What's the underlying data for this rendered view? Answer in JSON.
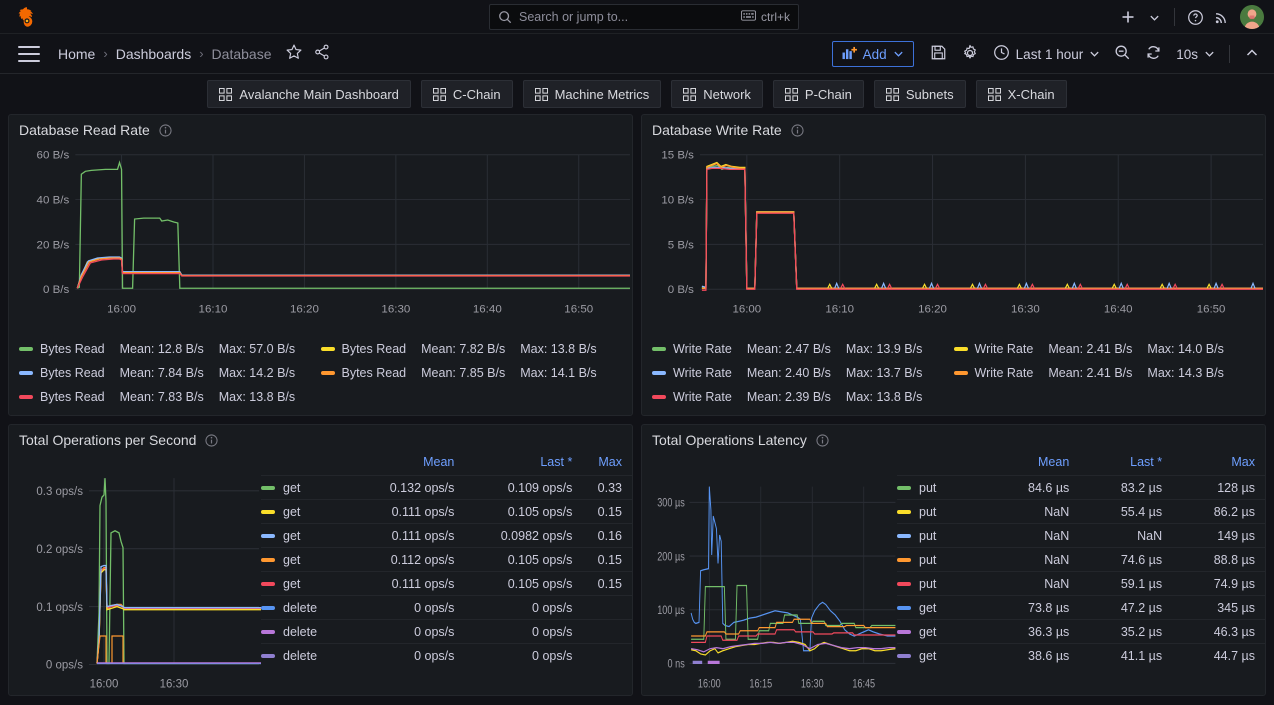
{
  "topnav": {
    "logo_icon": "grafana-logo-icon",
    "search": {
      "placeholder": "Search or jump to...",
      "icon": "search-icon",
      "kbd_icon": "keyboard-icon",
      "kbd_label": "ctrl+k"
    },
    "plus_label": "+",
    "help_icon": "help-circle-icon",
    "news_icon": "rss-news-icon",
    "avatar_icon": "user-avatar"
  },
  "breadcrumb": {
    "menu_icon": "hamburger-menu-icon",
    "items": [
      {
        "label": "Home"
      },
      {
        "label": "Dashboards"
      },
      {
        "label": "Database"
      }
    ],
    "separator": "›",
    "star_icon": "star-outline-icon",
    "share_icon": "share-nodes-icon"
  },
  "toolbar": {
    "add_label": "Add",
    "add_icon": "panel-add-icon",
    "add_chevron": "chevron-down-icon",
    "save_icon": "save-disk-icon",
    "settings_icon": "gear-icon",
    "time_icon": "clock-icon",
    "time_range": "Last 1 hour",
    "time_chevron": "chevron-down-icon",
    "zoom_out_icon": "zoom-out-icon",
    "refresh_icon": "refresh-icon",
    "refresh_interval": "10s",
    "refresh_chevron": "chevron-down-icon",
    "collapse_icon": "chevron-up-icon"
  },
  "dashboard_links": [
    {
      "label": "Avalanche Main Dashboard",
      "icon": "apps-grid-icon"
    },
    {
      "label": "C-Chain",
      "icon": "apps-grid-icon"
    },
    {
      "label": "Machine Metrics",
      "icon": "apps-grid-icon"
    },
    {
      "label": "Network",
      "icon": "apps-grid-icon"
    },
    {
      "label": "P-Chain",
      "icon": "apps-grid-icon"
    },
    {
      "label": "Subnets",
      "icon": "apps-grid-icon"
    },
    {
      "label": "X-Chain",
      "icon": "apps-grid-icon"
    }
  ],
  "colors": {
    "green": "#73BF69",
    "yellow": "#FADE2A",
    "blue": "#8AB8FF",
    "orange": "#FF9830",
    "red": "#F2495C",
    "blue2": "#5794F2",
    "purple": "#B877D9",
    "violet": "#8F7FD0",
    "accent_blue": "#6e9fff",
    "panel_bg": "#181b1f",
    "page_bg": "#111217"
  },
  "panels": [
    {
      "id": "database-read-rate",
      "title": "Database Read Rate",
      "info_icon": "info-circle-icon",
      "legend_layout": "list",
      "chart_data": {
        "type": "line",
        "title": "Database Read Rate",
        "xlabel": "",
        "ylabel": "",
        "ylim": [
          0,
          65
        ],
        "ytick_labels": [
          "0 B/s",
          "20 B/s",
          "40 B/s",
          "60 B/s"
        ],
        "ytick_values": [
          0,
          20,
          40,
          60
        ],
        "xtick_labels": [
          "16:00",
          "16:10",
          "16:20",
          "16:30",
          "16:40",
          "16:50"
        ],
        "grid": true,
        "legend_position": "bottom",
        "series": [
          {
            "name": "Bytes Read",
            "color": "#73BF69",
            "mean": "12.8 B/s",
            "max": "57.0 B/s"
          },
          {
            "name": "Bytes Read",
            "color": "#FADE2A",
            "mean": "7.82 B/s",
            "max": "13.8 B/s"
          },
          {
            "name": "Bytes Read",
            "color": "#8AB8FF",
            "mean": "7.84 B/s",
            "max": "14.2 B/s"
          },
          {
            "name": "Bytes Read",
            "color": "#FF9830",
            "mean": "7.85 B/s",
            "max": "14.1 B/s"
          },
          {
            "name": "Bytes Read",
            "color": "#F2495C",
            "mean": "7.83 B/s",
            "max": "13.8 B/s"
          }
        ]
      },
      "legend": [
        {
          "name": "Bytes Read",
          "color": "#73BF69",
          "stats": [
            "Mean: 12.8 B/s",
            "Max: 57.0 B/s"
          ]
        },
        {
          "name": "Bytes Read",
          "color": "#FADE2A",
          "stats": [
            "Mean: 7.82 B/s",
            "Max: 13.8 B/s"
          ]
        },
        {
          "name": "Bytes Read",
          "color": "#8AB8FF",
          "stats": [
            "Mean: 7.84 B/s",
            "Max: 14.2 B/s"
          ]
        },
        {
          "name": "Bytes Read",
          "color": "#FF9830",
          "stats": [
            "Mean: 7.85 B/s",
            "Max: 14.1 B/s"
          ]
        },
        {
          "name": "Bytes Read",
          "color": "#F2495C",
          "stats": [
            "Mean: 7.83 B/s",
            "Max: 13.8 B/s"
          ]
        }
      ]
    },
    {
      "id": "database-write-rate",
      "title": "Database Write Rate",
      "info_icon": "info-circle-icon",
      "legend_layout": "list",
      "chart_data": {
        "type": "line",
        "title": "Database Write Rate",
        "xlabel": "",
        "ylabel": "",
        "ylim": [
          0,
          16
        ],
        "ytick_labels": [
          "0 B/s",
          "5 B/s",
          "10 B/s",
          "15 B/s"
        ],
        "ytick_values": [
          0,
          5,
          10,
          15
        ],
        "xtick_labels": [
          "16:00",
          "16:10",
          "16:20",
          "16:30",
          "16:40",
          "16:50"
        ],
        "grid": true,
        "legend_position": "bottom",
        "series": [
          {
            "name": "Write Rate",
            "color": "#73BF69",
            "mean": "2.47 B/s",
            "max": "13.9 B/s"
          },
          {
            "name": "Write Rate",
            "color": "#FADE2A",
            "mean": "2.41 B/s",
            "max": "14.0 B/s"
          },
          {
            "name": "Write Rate",
            "color": "#8AB8FF",
            "mean": "2.40 B/s",
            "max": "13.7 B/s"
          },
          {
            "name": "Write Rate",
            "color": "#FF9830",
            "mean": "2.41 B/s",
            "max": "14.3 B/s"
          },
          {
            "name": "Write Rate",
            "color": "#F2495C",
            "mean": "2.39 B/s",
            "max": "13.8 B/s"
          }
        ]
      },
      "legend": [
        {
          "name": "Write Rate",
          "color": "#73BF69",
          "stats": [
            "Mean: 2.47 B/s",
            "Max: 13.9 B/s"
          ]
        },
        {
          "name": "Write Rate",
          "color": "#FADE2A",
          "stats": [
            "Mean: 2.41 B/s",
            "Max: 14.0 B/s"
          ]
        },
        {
          "name": "Write Rate",
          "color": "#8AB8FF",
          "stats": [
            "Mean: 2.40 B/s",
            "Max: 13.7 B/s"
          ]
        },
        {
          "name": "Write Rate",
          "color": "#FF9830",
          "stats": [
            "Mean: 2.41 B/s",
            "Max: 14.3 B/s"
          ]
        },
        {
          "name": "Write Rate",
          "color": "#F2495C",
          "stats": [
            "Mean: 2.39 B/s",
            "Max: 13.8 B/s"
          ]
        }
      ]
    },
    {
      "id": "total-operations-per-second",
      "title": "Total Operations per Second",
      "info_icon": "info-circle-icon",
      "legend_layout": "table",
      "chart_data": {
        "type": "line",
        "title": "Total Operations per Second",
        "xlabel": "",
        "ylabel": "",
        "ylim": [
          0,
          0.35
        ],
        "ytick_labels": [
          "0 ops/s",
          "0.1 ops/s",
          "0.2 ops/s",
          "0.3 ops/s"
        ],
        "ytick_values": [
          0,
          0.1,
          0.2,
          0.3
        ],
        "xtick_labels": [
          "16:00",
          "16:30"
        ],
        "grid": true,
        "legend_position": "right",
        "columns": [
          "",
          "Mean",
          "Last *",
          "Max"
        ],
        "series": [
          {
            "name": "get",
            "color": "#73BF69",
            "mean": "0.132 ops/s",
            "last": "0.109 ops/s",
            "max": "0.33"
          },
          {
            "name": "get",
            "color": "#FADE2A",
            "mean": "0.111 ops/s",
            "last": "0.105 ops/s",
            "max": "0.15"
          },
          {
            "name": "get",
            "color": "#8AB8FF",
            "mean": "0.111 ops/s",
            "last": "0.0982 ops/s",
            "max": "0.16"
          },
          {
            "name": "get",
            "color": "#FF9830",
            "mean": "0.112 ops/s",
            "last": "0.105 ops/s",
            "max": "0.15"
          },
          {
            "name": "get",
            "color": "#F2495C",
            "mean": "0.111 ops/s",
            "last": "0.105 ops/s",
            "max": "0.15"
          },
          {
            "name": "delete",
            "color": "#5794F2",
            "mean": "0 ops/s",
            "last": "0 ops/s",
            "max": ""
          },
          {
            "name": "delete",
            "color": "#B877D9",
            "mean": "0 ops/s",
            "last": "0 ops/s",
            "max": ""
          },
          {
            "name": "delete",
            "color": "#8F7FD0",
            "mean": "0 ops/s",
            "last": "0 ops/s",
            "max": ""
          }
        ]
      },
      "legend_header": [
        "",
        "Mean",
        "Last *",
        "Max"
      ],
      "legend": [
        {
          "name": "get",
          "color": "#73BF69",
          "mean": "0.132 ops/s",
          "last": "0.109 ops/s",
          "max": "0.33"
        },
        {
          "name": "get",
          "color": "#FADE2A",
          "mean": "0.111 ops/s",
          "last": "0.105 ops/s",
          "max": "0.15"
        },
        {
          "name": "get",
          "color": "#8AB8FF",
          "mean": "0.111 ops/s",
          "last": "0.0982 ops/s",
          "max": "0.16"
        },
        {
          "name": "get",
          "color": "#FF9830",
          "mean": "0.112 ops/s",
          "last": "0.105 ops/s",
          "max": "0.15"
        },
        {
          "name": "get",
          "color": "#F2495C",
          "mean": "0.111 ops/s",
          "last": "0.105 ops/s",
          "max": "0.15"
        },
        {
          "name": "delete",
          "color": "#5794F2",
          "mean": "0 ops/s",
          "last": "0 ops/s",
          "max": ""
        },
        {
          "name": "delete",
          "color": "#B877D9",
          "mean": "0 ops/s",
          "last": "0 ops/s",
          "max": ""
        },
        {
          "name": "delete",
          "color": "#8F7FD0",
          "mean": "0 ops/s",
          "last": "0 ops/s",
          "max": ""
        }
      ]
    },
    {
      "id": "total-operations-latency",
      "title": "Total Operations Latency",
      "info_icon": "info-circle-icon",
      "legend_layout": "table",
      "chart_data": {
        "type": "line",
        "title": "Total Operations Latency",
        "xlabel": "",
        "ylabel": "",
        "ylim": [
          0,
          350
        ],
        "ytick_labels": [
          "0 ns",
          "100 µs",
          "200 µs",
          "300 µs"
        ],
        "ytick_values": [
          0,
          100,
          200,
          300
        ],
        "xtick_labels": [
          "16:00",
          "16:15",
          "16:30",
          "16:45"
        ],
        "grid": true,
        "legend_position": "right",
        "columns": [
          "",
          "Mean",
          "Last *",
          "Max"
        ],
        "series": [
          {
            "name": "put",
            "color": "#73BF69",
            "mean": "84.6 µs",
            "last": "83.2 µs",
            "max": "128 µs"
          },
          {
            "name": "put",
            "color": "#FADE2A",
            "mean": "NaN",
            "last": "55.4 µs",
            "max": "86.2 µs"
          },
          {
            "name": "put",
            "color": "#8AB8FF",
            "mean": "NaN",
            "last": "NaN",
            "max": "149 µs"
          },
          {
            "name": "put",
            "color": "#FF9830",
            "mean": "NaN",
            "last": "74.6 µs",
            "max": "88.8 µs"
          },
          {
            "name": "put",
            "color": "#F2495C",
            "mean": "NaN",
            "last": "59.1 µs",
            "max": "74.9 µs"
          },
          {
            "name": "get",
            "color": "#5794F2",
            "mean": "73.8 µs",
            "last": "47.2 µs",
            "max": "345 µs"
          },
          {
            "name": "get",
            "color": "#B877D9",
            "mean": "36.3 µs",
            "last": "35.2 µs",
            "max": "46.3 µs"
          },
          {
            "name": "get",
            "color": "#8F7FD0",
            "mean": "38.6 µs",
            "last": "41.1 µs",
            "max": "44.7 µs"
          }
        ]
      },
      "legend_header": [
        "",
        "Mean",
        "Last *",
        "Max"
      ],
      "legend": [
        {
          "name": "put",
          "color": "#73BF69",
          "mean": "84.6 µs",
          "last": "83.2 µs",
          "max": "128 µs"
        },
        {
          "name": "put",
          "color": "#FADE2A",
          "mean": "NaN",
          "last": "55.4 µs",
          "max": "86.2 µs"
        },
        {
          "name": "put",
          "color": "#8AB8FF",
          "mean": "NaN",
          "last": "NaN",
          "max": "149 µs"
        },
        {
          "name": "put",
          "color": "#FF9830",
          "mean": "NaN",
          "last": "74.6 µs",
          "max": "88.8 µs"
        },
        {
          "name": "put",
          "color": "#F2495C",
          "mean": "NaN",
          "last": "59.1 µs",
          "max": "74.9 µs"
        },
        {
          "name": "get",
          "color": "#5794F2",
          "mean": "73.8 µs",
          "last": "47.2 µs",
          "max": "345 µs"
        },
        {
          "name": "get",
          "color": "#B877D9",
          "mean": "36.3 µs",
          "last": "35.2 µs",
          "max": "46.3 µs"
        },
        {
          "name": "get",
          "color": "#8F7FD0",
          "mean": "38.6 µs",
          "last": "41.1 µs",
          "max": "44.7 µs"
        }
      ]
    }
  ]
}
